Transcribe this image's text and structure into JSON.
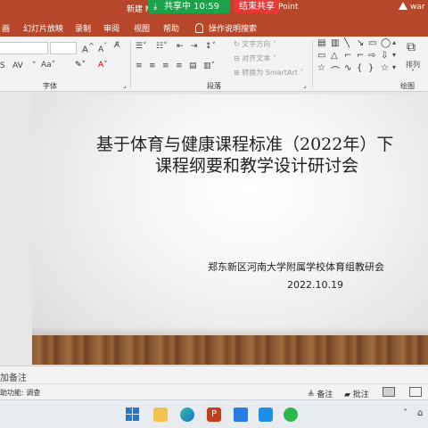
{
  "titlebar": {
    "title_left": "新建 M",
    "title_right": "Point",
    "share_status": "共享中 10:59",
    "end_share": "结束共享",
    "user": "war"
  },
  "menu": [
    "画",
    "幻灯片放映",
    "录制",
    "审阅",
    "视图",
    "帮助",
    "操作说明搜索"
  ],
  "ribbon": {
    "text_direction": "文字方向",
    "align_text": "对齐文本",
    "smartart": "转换为 SmartArt",
    "arrange": "排列",
    "groups": {
      "font": "字体",
      "paragraph": "段落",
      "drawing": "绘图"
    }
  },
  "slide": {
    "title_line1": "基于体育与健康课程标准（2022年）下",
    "title_line2": "课程纲要和教学设计研讨会",
    "organizer": "郑东新区河南大学附属学校体育组教研会",
    "date": "2022.10.19"
  },
  "notes": {
    "placeholder": "加备注"
  },
  "statusbar": {
    "accessibility": "助功能: 调查",
    "notes_btn": "备注",
    "comments_btn": "批注"
  },
  "colors": {
    "titlebar": "#b7472a",
    "share_green": "#1aa34a",
    "end_red": "#e53935"
  }
}
